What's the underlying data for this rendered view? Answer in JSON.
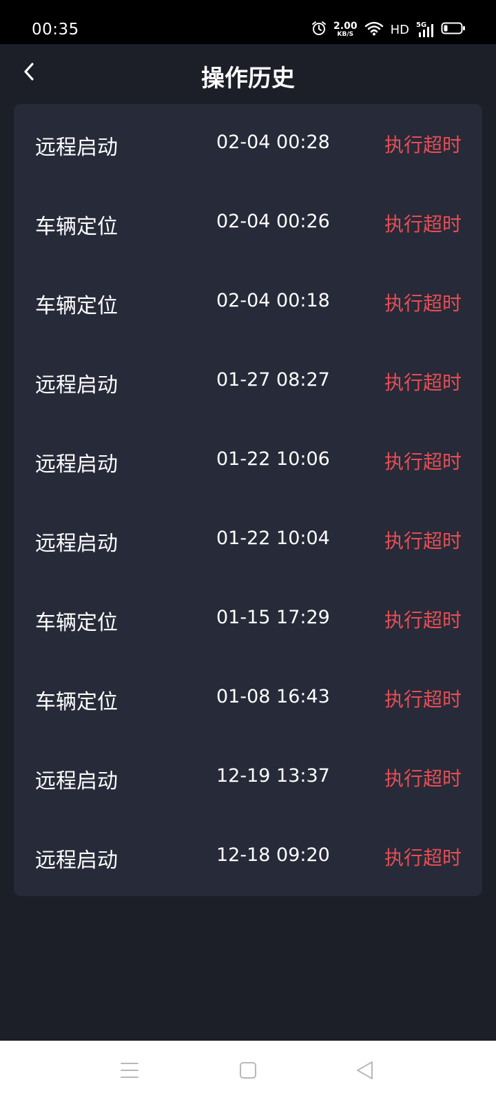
{
  "status_bar": {
    "time": "00:35",
    "net_speed_value": "2.00",
    "net_speed_unit": "KB/S",
    "hd": "HD",
    "signal_label": "5G"
  },
  "header": {
    "title": "操作历史"
  },
  "history": [
    {
      "action": "远程启动",
      "time": "02-04 00:28",
      "status": "执行超时"
    },
    {
      "action": "车辆定位",
      "time": "02-04 00:26",
      "status": "执行超时"
    },
    {
      "action": "车辆定位",
      "time": "02-04 00:18",
      "status": "执行超时"
    },
    {
      "action": "远程启动",
      "time": "01-27 08:27",
      "status": "执行超时"
    },
    {
      "action": "远程启动",
      "time": "01-22 10:06",
      "status": "执行超时"
    },
    {
      "action": "远程启动",
      "time": "01-22 10:04",
      "status": "执行超时"
    },
    {
      "action": "车辆定位",
      "time": "01-15 17:29",
      "status": "执行超时"
    },
    {
      "action": "车辆定位",
      "time": "01-08 16:43",
      "status": "执行超时"
    },
    {
      "action": "远程启动",
      "time": "12-19 13:37",
      "status": "执行超时"
    },
    {
      "action": "远程启动",
      "time": "12-18 09:20",
      "status": "执行超时"
    }
  ],
  "colors": {
    "background": "#1c1e28",
    "card": "#272a38",
    "status_timeout": "#e64e55"
  },
  "icons": {
    "back": "chevron-left-icon",
    "alarm": "alarm-clock-icon",
    "wifi": "wifi-icon",
    "signal": "cellular-signal-icon",
    "battery": "battery-icon",
    "nav_menu": "menu-icon",
    "nav_home": "square-home-icon",
    "nav_back": "triangle-back-icon"
  }
}
